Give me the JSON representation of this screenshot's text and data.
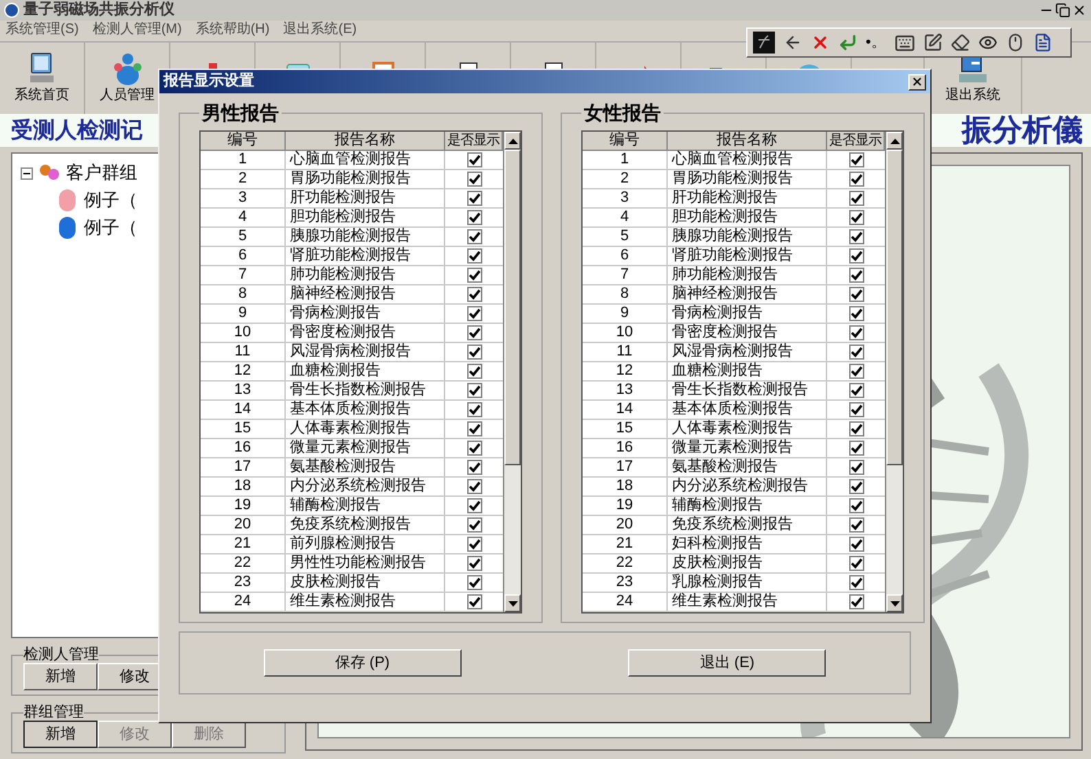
{
  "window": {
    "title": "量子弱磁场共振分析仪"
  },
  "menu": [
    {
      "label": "系统管理(S)"
    },
    {
      "label": "检测人管理(M)"
    },
    {
      "label": "系统帮助(H)"
    },
    {
      "label": "退出系统(E)"
    }
  ],
  "toolbar": [
    {
      "kind": "monitor",
      "label": "系统首页"
    },
    {
      "kind": "people",
      "label": "人员管理"
    },
    {
      "kind": "org"
    },
    {
      "kind": "clipboard"
    },
    {
      "kind": "report"
    },
    {
      "kind": "printer"
    },
    {
      "kind": "printer"
    },
    {
      "kind": "arrows"
    },
    {
      "kind": "folder"
    },
    {
      "kind": "globe"
    },
    {
      "kind": "exit",
      "label": "退出系统"
    }
  ],
  "ime_toolbar": {
    "symbol": "•。"
  },
  "left_heading": "受测人检测记",
  "right_heading": "振分析儀",
  "tree": {
    "label": "客户群组",
    "expanded": true,
    "children": [
      {
        "label": "例子（",
        "color": "#f2a0a8"
      },
      {
        "label": "例子（",
        "color": "#1e6fd8"
      }
    ]
  },
  "tester_group": {
    "title": "检测人管理",
    "buttons": [
      {
        "label": "新增",
        "disabled": false
      },
      {
        "label": "修改",
        "disabled": false
      }
    ]
  },
  "group_management": {
    "title": "群组管理",
    "buttons": [
      {
        "label": "新增",
        "disabled": false
      },
      {
        "label": "修改",
        "disabled": true
      },
      {
        "label": "删除",
        "disabled": true
      }
    ]
  },
  "dialog": {
    "title": "报告显示设置",
    "panels": [
      {
        "title": "男性报告",
        "columns": [
          "编号",
          "报告名称",
          "是否显示"
        ],
        "rows": [
          {
            "number": "1",
            "name": "心脑血管检测报告",
            "shown": true
          },
          {
            "number": "2",
            "name": "胃肠功能检测报告",
            "shown": true
          },
          {
            "number": "3",
            "name": "肝功能检测报告",
            "shown": true
          },
          {
            "number": "4",
            "name": "胆功能检测报告",
            "shown": true
          },
          {
            "number": "5",
            "name": "胰腺功能检测报告",
            "shown": true
          },
          {
            "number": "6",
            "name": "肾脏功能检测报告",
            "shown": true
          },
          {
            "number": "7",
            "name": "肺功能检测报告",
            "shown": true
          },
          {
            "number": "8",
            "name": "脑神经检测报告",
            "shown": true
          },
          {
            "number": "9",
            "name": "骨病检测报告",
            "shown": true
          },
          {
            "number": "10",
            "name": "骨密度检测报告",
            "shown": true
          },
          {
            "number": "11",
            "name": "风湿骨病检测报告",
            "shown": true
          },
          {
            "number": "12",
            "name": "血糖检测报告",
            "shown": true
          },
          {
            "number": "13",
            "name": "骨生长指数检测报告",
            "shown": true
          },
          {
            "number": "14",
            "name": "基本体质检测报告",
            "shown": true
          },
          {
            "number": "15",
            "name": "人体毒素检测报告",
            "shown": true
          },
          {
            "number": "16",
            "name": "微量元素检测报告",
            "shown": true
          },
          {
            "number": "17",
            "name": "氨基酸检测报告",
            "shown": true
          },
          {
            "number": "18",
            "name": "内分泌系统检测报告",
            "shown": true
          },
          {
            "number": "19",
            "name": "辅酶检测报告",
            "shown": true
          },
          {
            "number": "20",
            "name": "免疫系统检测报告",
            "shown": true
          },
          {
            "number": "21",
            "name": "前列腺检测报告",
            "shown": true
          },
          {
            "number": "22",
            "name": "男性性功能检测报告",
            "shown": true
          },
          {
            "number": "23",
            "name": "皮肤检测报告",
            "shown": true
          },
          {
            "number": "24",
            "name": "维生素检测报告",
            "shown": true
          }
        ]
      },
      {
        "title": "女性报告",
        "columns": [
          "编号",
          "报告名称",
          "是否显示"
        ],
        "rows": [
          {
            "number": "1",
            "name": "心脑血管检测报告",
            "shown": true
          },
          {
            "number": "2",
            "name": "胃肠功能检测报告",
            "shown": true
          },
          {
            "number": "3",
            "name": "肝功能检测报告",
            "shown": true
          },
          {
            "number": "4",
            "name": "胆功能检测报告",
            "shown": true
          },
          {
            "number": "5",
            "name": "胰腺功能检测报告",
            "shown": true
          },
          {
            "number": "6",
            "name": "肾脏功能检测报告",
            "shown": true
          },
          {
            "number": "7",
            "name": "肺功能检测报告",
            "shown": true
          },
          {
            "number": "8",
            "name": "脑神经检测报告",
            "shown": true
          },
          {
            "number": "9",
            "name": "骨病检测报告",
            "shown": true
          },
          {
            "number": "10",
            "name": "骨密度检测报告",
            "shown": true
          },
          {
            "number": "11",
            "name": "风湿骨病检测报告",
            "shown": true
          },
          {
            "number": "12",
            "name": "血糖检测报告",
            "shown": true
          },
          {
            "number": "13",
            "name": "骨生长指数检测报告",
            "shown": true
          },
          {
            "number": "14",
            "name": "基本体质检测报告",
            "shown": true
          },
          {
            "number": "15",
            "name": "人体毒素检测报告",
            "shown": true
          },
          {
            "number": "16",
            "name": "微量元素检测报告",
            "shown": true
          },
          {
            "number": "17",
            "name": "氨基酸检测报告",
            "shown": true
          },
          {
            "number": "18",
            "name": "内分泌系统检测报告",
            "shown": true
          },
          {
            "number": "19",
            "name": "辅酶检测报告",
            "shown": true
          },
          {
            "number": "20",
            "name": "免疫系统检测报告",
            "shown": true
          },
          {
            "number": "21",
            "name": "妇科检测报告",
            "shown": true
          },
          {
            "number": "22",
            "name": "皮肤检测报告",
            "shown": true
          },
          {
            "number": "23",
            "name": "乳腺检测报告",
            "shown": true
          },
          {
            "number": "24",
            "name": "维生素检测报告",
            "shown": true
          }
        ]
      }
    ],
    "buttons": [
      "保存 (P)",
      "退出 (E)"
    ]
  }
}
